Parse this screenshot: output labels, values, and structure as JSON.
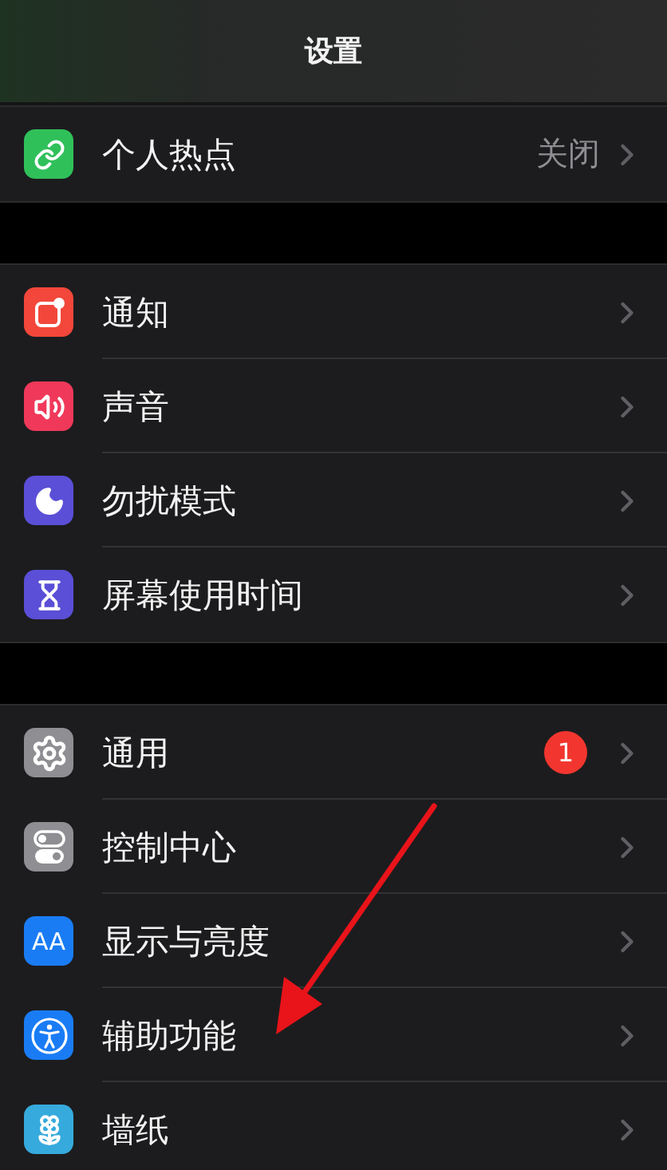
{
  "header": {
    "title": "设置"
  },
  "sections": [
    {
      "rows": [
        {
          "kind": "link",
          "color": "#30c05a",
          "label": "个人热点",
          "value": "关闭"
        }
      ]
    },
    {
      "rows": [
        {
          "kind": "notification",
          "color": "#f2473a",
          "label": "通知"
        },
        {
          "kind": "sound",
          "color": "#f0395a",
          "label": "声音"
        },
        {
          "kind": "moon",
          "color": "#5a4fd6",
          "label": "勿扰模式"
        },
        {
          "kind": "hourglass",
          "color": "#5a4fd6",
          "label": "屏幕使用时间"
        }
      ]
    },
    {
      "rows": [
        {
          "kind": "gear",
          "color": "#8e8e93",
          "label": "通用",
          "badge": "1"
        },
        {
          "kind": "toggles",
          "color": "#8e8e93",
          "label": "控制中心"
        },
        {
          "kind": "text",
          "icon_text": "AA",
          "color": "#1a7cf5",
          "label": "显示与亮度"
        },
        {
          "kind": "person",
          "color": "#1a7cf5",
          "label": "辅助功能"
        },
        {
          "kind": "flower",
          "color": "#36aadc",
          "label": "墙纸"
        }
      ]
    }
  ],
  "annotation": {
    "kind": "arrow"
  }
}
